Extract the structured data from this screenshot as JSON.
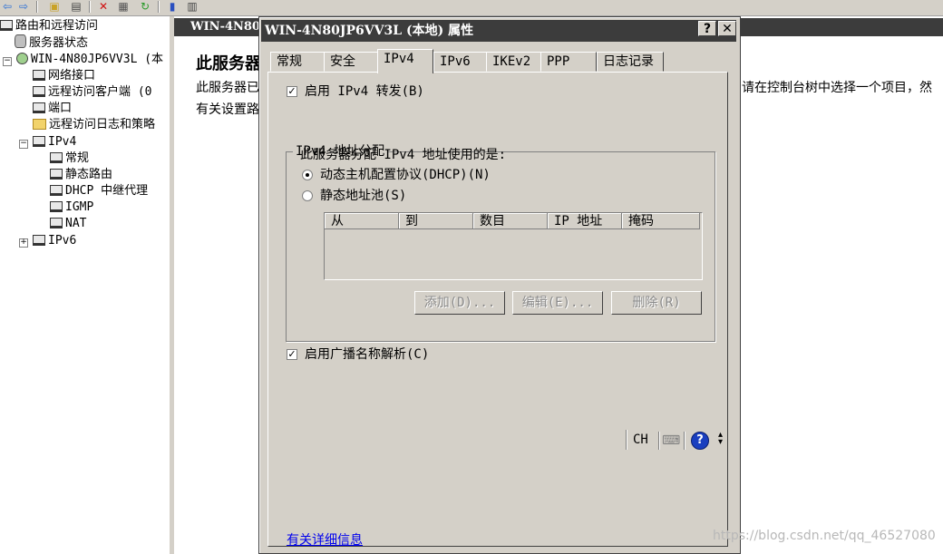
{
  "toolbar": {
    "icons": [
      "back-arrow-icon",
      "forward-arrow-icon",
      "up-folder-icon",
      "show-pane-icon",
      "delete-icon",
      "properties-icon",
      "refresh-icon",
      "help-book-icon",
      "console-pane-icon"
    ]
  },
  "tree": {
    "items": [
      {
        "label": "路由和远程访问"
      },
      {
        "label": "服务器状态"
      },
      {
        "label": "WIN-4N80JP6VV3L (本"
      },
      {
        "label": "网络接口"
      },
      {
        "label": "远程访问客户端 (0"
      },
      {
        "label": "端口"
      },
      {
        "label": "远程访问日志和策略"
      },
      {
        "label": "IPv4"
      },
      {
        "label": "常规"
      },
      {
        "label": "静态路由"
      },
      {
        "label": "DHCP 中继代理"
      },
      {
        "label": "IGMP"
      },
      {
        "label": "NAT"
      },
      {
        "label": "IPv6"
      }
    ]
  },
  "right_pane": {
    "header": "WIN-4N80.",
    "title": "此服务器",
    "text_left_1": "此服务器已",
    "text_left_2": "有关设置路",
    "text_right_1": "请在控制台树中选择一个项目，然"
  },
  "dialog": {
    "title": "WIN-4N80JP6VV3L (本地) 属性",
    "help_btn": "?",
    "close_btn": "✕",
    "tabs": [
      "常规",
      "安全",
      "IPv4",
      "IPv6",
      "IKEv2",
      "PPP",
      "日志记录"
    ],
    "active_tab": "IPv4",
    "enable_ipv4_forwarding": {
      "label": "启用 IPv4 转发(B)",
      "checked": true
    },
    "group_title": "IPv4 地址分配",
    "group_desc": "此服务器分配 IPv4 地址使用的是:",
    "radio_dhcp": {
      "label": "动态主机配置协议(DHCP)(N)",
      "selected": true
    },
    "radio_pool": {
      "label": "静态地址池(S)",
      "selected": false
    },
    "columns": [
      "从",
      "到",
      "数目",
      "IP 地址",
      "掩码"
    ],
    "buttons": {
      "add": "添加(D)...",
      "edit": "编辑(E)...",
      "delete": "删除(R)"
    },
    "enable_broadcast": {
      "label": "启用广播名称解析(C)",
      "checked": true
    },
    "more_info_link": "有关详细信息"
  },
  "language_bar": {
    "lang": "CH",
    "help": "?"
  },
  "watermark": "https://blog.csdn.net/qq_46527080"
}
